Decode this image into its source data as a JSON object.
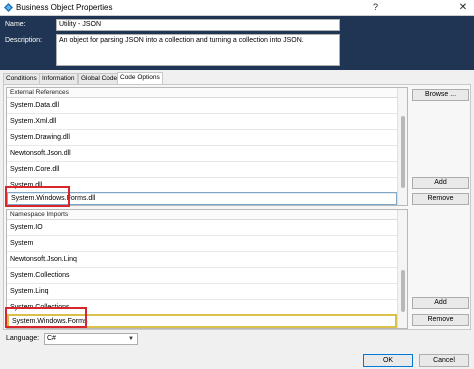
{
  "window": {
    "title": "Business Object Properties",
    "help_glyph": "?",
    "close_glyph": "✕"
  },
  "header": {
    "name_label": "Name:",
    "name_value": "Utility - JSON",
    "description_label": "Description:",
    "description_value": "An object for parsing JSON into a collection and turning a collection into JSON."
  },
  "tabs": [
    {
      "label": "Conditions",
      "active": false
    },
    {
      "label": "Information",
      "active": false
    },
    {
      "label": "Global Code",
      "active": false
    },
    {
      "label": "Code Options",
      "active": true
    }
  ],
  "external_references": {
    "header": "External References",
    "items": [
      "System.Data.dll",
      "System.Xml.dll",
      "System.Drawing.dll",
      "Newtonsoft.Json.dll",
      "System.Core.dll",
      "System.dll",
      "System.Windows.Forms.dll"
    ],
    "browse_label": "Browse ...",
    "add_label": "Add",
    "remove_label": "Remove"
  },
  "namespace_imports": {
    "header": "Namespace Imports",
    "items": [
      "System.IO",
      "System",
      "Newtonsoft.Json.Linq",
      "System.Collections",
      "System.Linq",
      "System.Collections",
      "System.Windows.Forms"
    ],
    "add_label": "Add",
    "remove_label": "Remove"
  },
  "language": {
    "label": "Language:",
    "value": "C#"
  },
  "footer": {
    "ok_label": "OK",
    "cancel_label": "Cancel"
  },
  "colors": {
    "header_bg": "#1f3553",
    "highlight_red": "#d9262c",
    "editing_yellow": "#d8c04a",
    "ok_border": "#0078d7"
  },
  "icons": {
    "app": "blueprism-diamond-icon"
  }
}
